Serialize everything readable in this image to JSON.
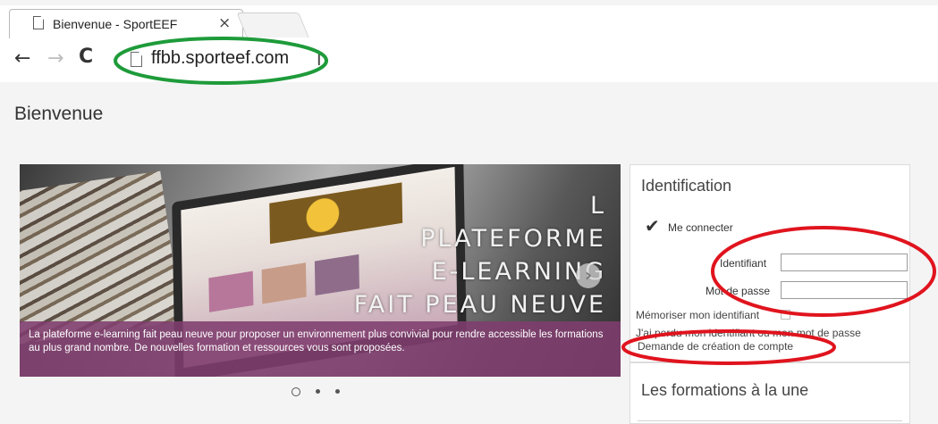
{
  "browser": {
    "tab_title": "Bienvenue - SportEEF",
    "tab_close": "×",
    "url": "ffbb.sporteef.com",
    "url_cursor": "I",
    "nav": {
      "back": "←",
      "forward": "→",
      "reload": "C"
    }
  },
  "page": {
    "title": "Bienvenue"
  },
  "banner": {
    "headline_lines": [
      "L",
      "PLATEFORME",
      "E-LEARNING",
      "FAIT PEAU NEUVE"
    ],
    "arrow": "›",
    "caption": "La plateforme e-learning fait peau neuve pour proposer un environnement plus convivial pour rendre accessible les formations au plus grand nombre. De nouvelles formation et ressources vous sont proposées.",
    "dots": {
      "count": 3,
      "active": 0
    }
  },
  "login": {
    "title": "Identification",
    "connect_label": "Me connecter",
    "username_label": "Identifiant",
    "username_value": "",
    "password_label": "Mot de passe",
    "password_value": "",
    "remember_label": "Mémoriser mon identifiant",
    "forgot_link": "J'ai perdu mon identifiant ou mon mot de passe",
    "create_account_link": "Demande de création de compte"
  },
  "featured": {
    "title": "Les formations à la une"
  },
  "colors": {
    "annotation_green": "#1e9b3a",
    "annotation_red": "#e0141e",
    "caption_purple": "#803e6e"
  }
}
